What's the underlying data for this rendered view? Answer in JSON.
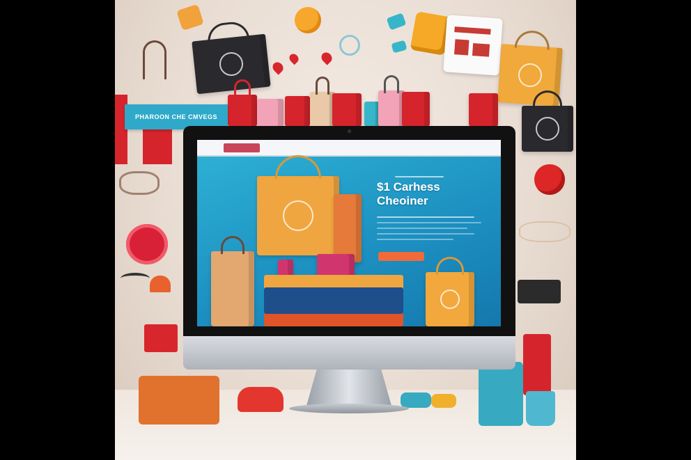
{
  "scene": {
    "background_color": "#e9ddd3",
    "banner_sign": {
      "text": "PHAROON CHE CMVEGS",
      "color": "#2ea9c9"
    },
    "monitor": {
      "screen": {
        "heading_line1": "$1 Carhess",
        "heading_line2": "Cheoiner",
        "accent_color": "#1c8fc0",
        "cta_color": "#f06a3a"
      }
    },
    "icons": [
      "shopping-bag-icon",
      "heart-icon",
      "gift-box-icon",
      "toy-car-icon",
      "hanger-icon",
      "sunglasses-icon"
    ]
  }
}
